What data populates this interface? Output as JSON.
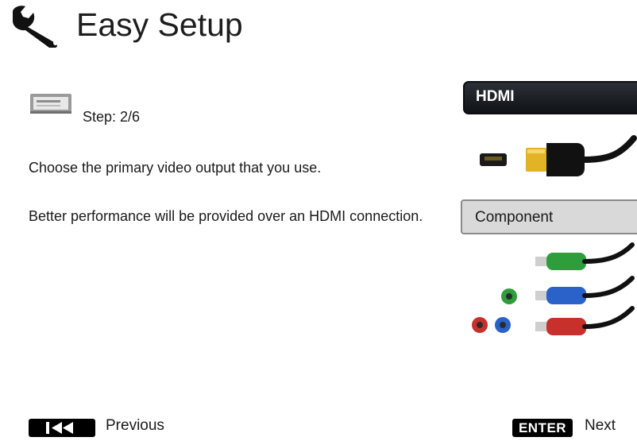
{
  "header": {
    "title": "Easy Setup",
    "icon": "wrench-icon"
  },
  "step": {
    "label": "Step: 2/6",
    "icon": "video-device-icon"
  },
  "instruction": "Choose the primary video output that you use.",
  "note": "Better performance will be provided over an HDMI connection.",
  "options": {
    "hdmi": {
      "label": "HDMI",
      "selected": true,
      "icon": "hdmi-cable-icon"
    },
    "component": {
      "label": "Component",
      "selected": false,
      "icon": "component-cables-icon"
    }
  },
  "footer": {
    "previous": {
      "label": "Previous",
      "key_icon": "skip-back-icon"
    },
    "next": {
      "label": "Next",
      "key_label": "ENTER"
    }
  },
  "colors": {
    "selected_bg": "#1a1e24",
    "unselected_bg": "#d9d9d9",
    "cable_green": "#2e9e3c",
    "cable_blue": "#2a62c9",
    "cable_red": "#c8302c"
  }
}
